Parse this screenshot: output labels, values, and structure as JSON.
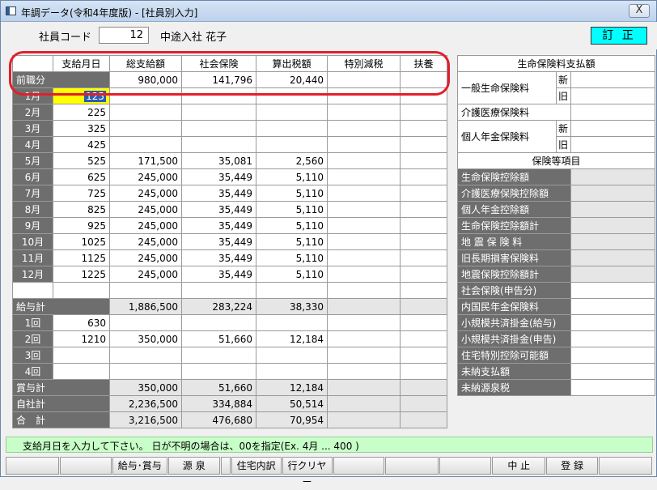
{
  "window": {
    "title": "年調データ(令和4年度版) - [社員別入力]",
    "close_label": "X"
  },
  "header": {
    "employee_code_label": "社員コード",
    "employee_code": "12",
    "employee_name": "中途入社  花子",
    "mode": "訂 正"
  },
  "main": {
    "columns": [
      "",
      "支給月日",
      "総支給額",
      "社会保険",
      "算出税額",
      "特別減税",
      "扶養"
    ],
    "prior_row": {
      "label": "前職分",
      "gross": "980,000",
      "insurance": "141,796",
      "tax": "20,440"
    },
    "months": [
      {
        "label": "1月",
        "day": "125",
        "gross": "",
        "insurance": "",
        "tax": ""
      },
      {
        "label": "2月",
        "day": "225",
        "gross": "",
        "insurance": "",
        "tax": ""
      },
      {
        "label": "3月",
        "day": "325",
        "gross": "",
        "insurance": "",
        "tax": ""
      },
      {
        "label": "4月",
        "day": "425",
        "gross": "",
        "insurance": "",
        "tax": ""
      },
      {
        "label": "5月",
        "day": "525",
        "gross": "171,500",
        "insurance": "35,081",
        "tax": "2,560"
      },
      {
        "label": "6月",
        "day": "625",
        "gross": "245,000",
        "insurance": "35,449",
        "tax": "5,110"
      },
      {
        "label": "7月",
        "day": "725",
        "gross": "245,000",
        "insurance": "35,449",
        "tax": "5,110"
      },
      {
        "label": "8月",
        "day": "825",
        "gross": "245,000",
        "insurance": "35,449",
        "tax": "5,110"
      },
      {
        "label": "9月",
        "day": "925",
        "gross": "245,000",
        "insurance": "35,449",
        "tax": "5,110"
      },
      {
        "label": "10月",
        "day": "1025",
        "gross": "245,000",
        "insurance": "35,449",
        "tax": "5,110"
      },
      {
        "label": "11月",
        "day": "1125",
        "gross": "245,000",
        "insurance": "35,449",
        "tax": "5,110"
      },
      {
        "label": "12月",
        "day": "1225",
        "gross": "245,000",
        "insurance": "35,449",
        "tax": "5,110"
      }
    ],
    "salary_total": {
      "label": "給与計",
      "gross": "1,886,500",
      "insurance": "283,224",
      "tax": "38,330"
    },
    "bonuses": [
      {
        "label": "1回",
        "day": "630",
        "gross": "",
        "insurance": "",
        "tax": ""
      },
      {
        "label": "2回",
        "day": "1210",
        "gross": "350,000",
        "insurance": "51,660",
        "tax": "12,184"
      },
      {
        "label": "3回",
        "day": "",
        "gross": "",
        "insurance": "",
        "tax": ""
      },
      {
        "label": "4回",
        "day": "",
        "gross": "",
        "insurance": "",
        "tax": ""
      }
    ],
    "bonus_total": {
      "label": "賞与計",
      "gross": "350,000",
      "insurance": "51,660",
      "tax": "12,184"
    },
    "company_total": {
      "label": "自社計",
      "gross": "2,236,500",
      "insurance": "334,884",
      "tax": "50,514"
    },
    "grand_total": {
      "label": "合　計",
      "gross": "3,216,500",
      "insurance": "476,680",
      "tax": "70,954"
    }
  },
  "life_insurance": {
    "title": "生命保険料支払額",
    "general": "一般生命保険料",
    "care": "介護医療保険料",
    "pension": "個人年金保険料",
    "new": "新",
    "old": "旧"
  },
  "insurance_items": {
    "title": "保険等項目",
    "items": [
      "生命保険控除額",
      "介護医療保険控除額",
      "個人年金控除額",
      "生命保険控除額計",
      "地 震 保 険 料",
      "旧長期損害保険料",
      "地震保険控除額計",
      "社会保険(申告分)",
      "内国民年金保険料",
      "小規模共済掛金(給与)",
      "小規模共済掛金(申告)",
      "住宅特別控除可能額",
      "未納支払額",
      "未納源泉税"
    ]
  },
  "status": {
    "message": "支給月日を入力して下さい。 日が不明の場合は、00を指定(Ex. 4月 ... 400 )"
  },
  "buttons": {
    "salary_bonus": "給与･賞与",
    "withholding": "源  泉",
    "housing": "住宅内訳",
    "row_clear": "行クリヤー",
    "cancel": "中  止",
    "register": "登  録"
  },
  "colors": {
    "mode_badge": "#00ffff",
    "status_bar": "#c8ffc8",
    "highlight_oval": "#e0202c",
    "selected_cell": "#ffff00"
  }
}
